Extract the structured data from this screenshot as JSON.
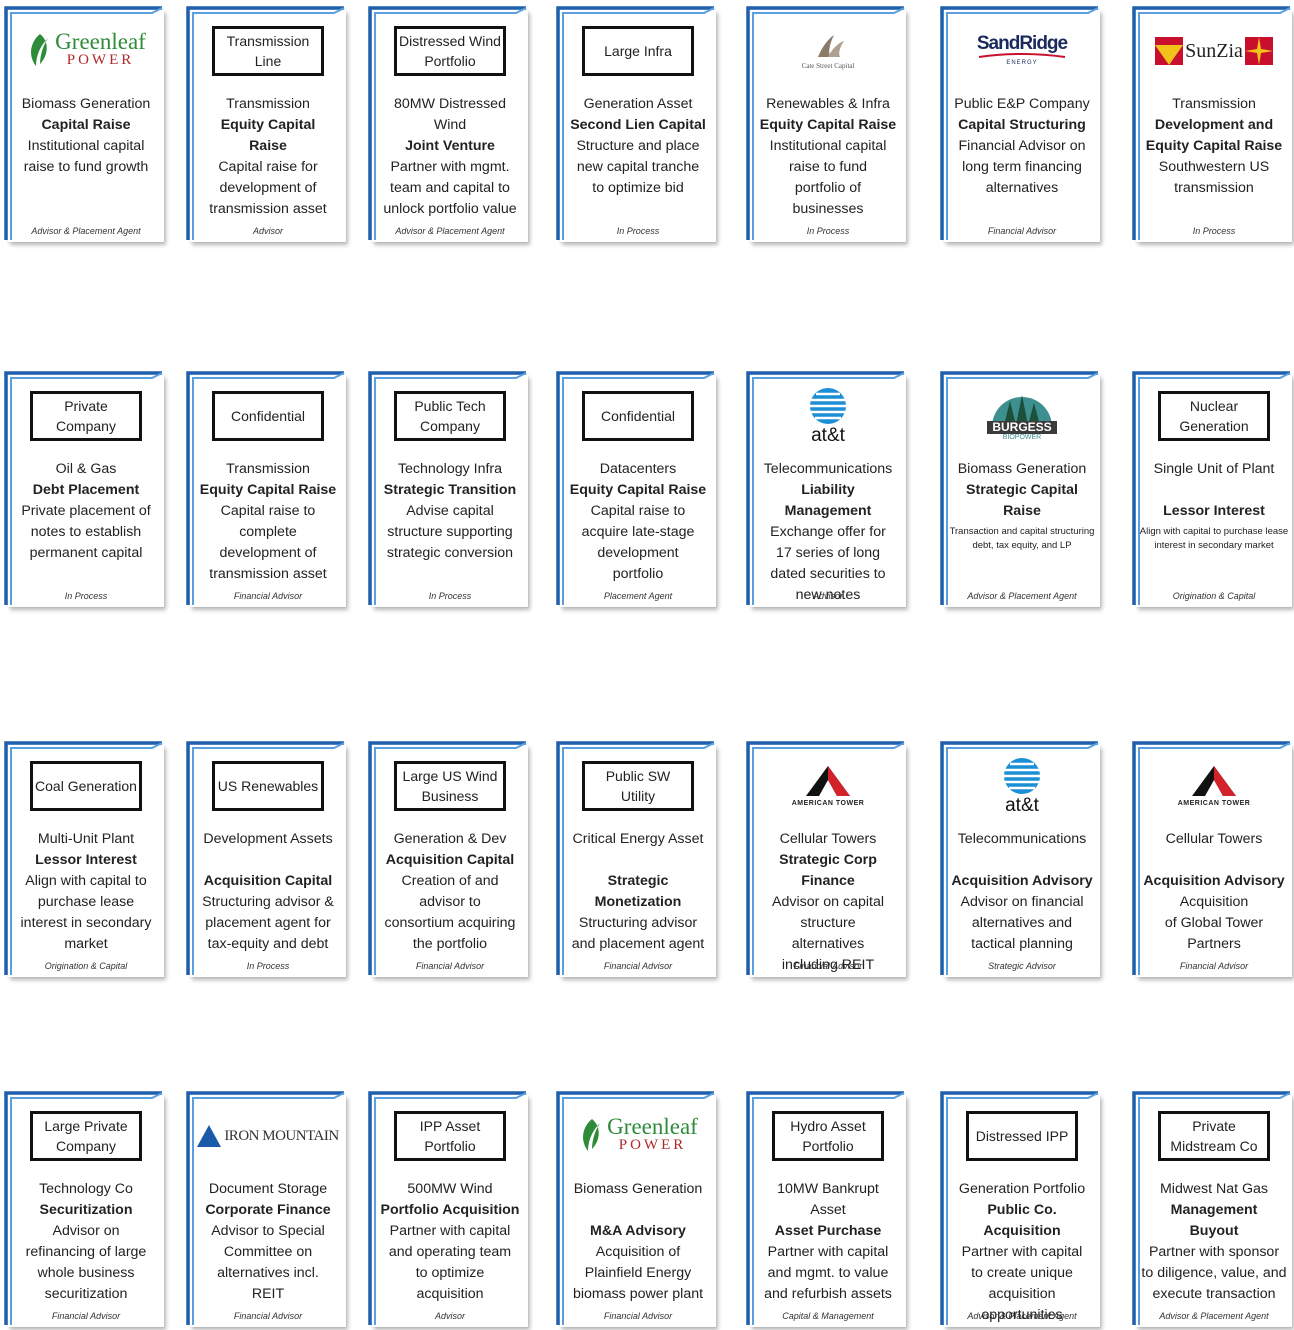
{
  "cards": [
    {
      "logo": "greenleaf",
      "logo_text": [
        "Greenleaf",
        "POWER"
      ],
      "lines": [
        {
          "t": "Biomass Generation"
        },
        {
          "t": "Capital Raise",
          "b": true
        },
        {
          "t": "Institutional capital"
        },
        {
          "t": "raise to fund growth"
        }
      ],
      "role": "Advisor & Placement Agent"
    },
    {
      "box": "Transmission Line",
      "lines": [
        {
          "t": "Transmission"
        },
        {
          "t": "Equity Capital",
          "b": true
        },
        {
          "t": "Raise",
          "b": true
        },
        {
          "t": "Capital raise for"
        },
        {
          "t": "development of"
        },
        {
          "t": "transmission asset"
        }
      ],
      "role": "Advisor"
    },
    {
      "box": "Distressed Wind Portfolio",
      "lines": [
        {
          "t": "80MW Distressed"
        },
        {
          "t": "Wind"
        },
        {
          "t": "Joint Venture",
          "b": true
        },
        {
          "t": "Partner with mgmt."
        },
        {
          "t": "team and capital to"
        },
        {
          "t": "unlock portfolio value"
        }
      ],
      "role": "Advisor & Placement Agent"
    },
    {
      "box": "Large Infra",
      "lines": [
        {
          "t": "Generation Asset"
        },
        {
          "t": "Second Lien Capital",
          "b": true
        },
        {
          "t": "Structure and place"
        },
        {
          "t": "new capital tranche"
        },
        {
          "t": "to optimize bid"
        }
      ],
      "role": "In Process"
    },
    {
      "logo": "catestreet",
      "logo_text": [
        "Cate Street Capital"
      ],
      "lines": [
        {
          "t": "Renewables & Infra"
        },
        {
          "t": "Equity Capital Raise",
          "b": true
        },
        {
          "t": "Institutional capital"
        },
        {
          "t": "raise to fund"
        },
        {
          "t": "portfolio of"
        },
        {
          "t": "businesses"
        }
      ],
      "role": "In Process"
    },
    {
      "logo": "sandridge",
      "logo_text": [
        "SandRidge",
        "ENERGY"
      ],
      "lines": [
        {
          "t": "Public E&P Company"
        },
        {
          "t": "Capital Structuring",
          "b": true
        },
        {
          "t": "Financial Advisor on"
        },
        {
          "t": "long term financing"
        },
        {
          "t": "alternatives"
        }
      ],
      "role": "Financial Advisor"
    },
    {
      "logo": "sunzia",
      "logo_text": [
        "SunZia"
      ],
      "lines": [
        {
          "t": "Transmission"
        },
        {
          "t": "Development and",
          "b": true
        },
        {
          "t": "Equity Capital Raise",
          "b": true
        },
        {
          "t": "Southwestern US"
        },
        {
          "t": "transmission"
        }
      ],
      "role": "In Process"
    },
    {
      "box": "Private Company",
      "lines": [
        {
          "t": "Oil & Gas"
        },
        {
          "t": "Debt Placement",
          "b": true
        },
        {
          "t": "Private placement of"
        },
        {
          "t": "notes to establish"
        },
        {
          "t": "permanent capital"
        }
      ],
      "role": "In Process"
    },
    {
      "box": "Confidential",
      "lines": [
        {
          "t": "Transmission"
        },
        {
          "t": "Equity Capital Raise",
          "b": true
        },
        {
          "t": "Capital raise to"
        },
        {
          "t": "complete"
        },
        {
          "t": "development of"
        },
        {
          "t": "transmission asset"
        }
      ],
      "role": "Financial Advisor"
    },
    {
      "box": "Public Tech Company",
      "lines": [
        {
          "t": "Technology Infra"
        },
        {
          "t": "Strategic Transition",
          "b": true
        },
        {
          "t": "Advise capital"
        },
        {
          "t": "structure supporting"
        },
        {
          "t": "strategic conversion"
        }
      ],
      "role": "In Process"
    },
    {
      "box": "Confidential",
      "lines": [
        {
          "t": "Datacenters"
        },
        {
          "t": "Equity Capital Raise",
          "b": true
        },
        {
          "t": "Capital raise to"
        },
        {
          "t": "acquire late-stage"
        },
        {
          "t": "development"
        },
        {
          "t": "portfolio"
        }
      ],
      "role": "Placement Agent"
    },
    {
      "logo": "att",
      "logo_text": [
        "at&t"
      ],
      "lines": [
        {
          "t": "Telecommunications"
        },
        {
          "t": "Liability",
          "b": true
        },
        {
          "t": "Management",
          "b": true
        },
        {
          "t": "Exchange offer for"
        },
        {
          "t": "17 series of long"
        },
        {
          "t": "dated securities to"
        },
        {
          "t": "new notes"
        }
      ],
      "role": "Advisor"
    },
    {
      "logo": "burgess",
      "logo_text": [
        "BURGESS",
        "BIOPOWER"
      ],
      "lines": [
        {
          "t": "Biomass Generation"
        },
        {
          "t": "Strategic Capital",
          "b": true
        },
        {
          "t": "Raise",
          "b": true
        },
        {
          "t": "Transaction and capital structuring debt, tax equity, and LP",
          "sm": true
        }
      ],
      "role": "Advisor & Placement Agent"
    },
    {
      "box": "Nuclear Generation",
      "lines": [
        {
          "t": "Single Unit of Plant"
        },
        {
          "gap": true
        },
        {
          "t": "Lessor Interest",
          "b": true
        },
        {
          "t": "Align with capital to purchase lease interest in secondary market",
          "sm": true
        }
      ],
      "role": "Origination & Capital"
    },
    {
      "box": "Coal Generation",
      "lines": [
        {
          "t": "Multi-Unit Plant"
        },
        {
          "t": "Lessor Interest",
          "b": true
        },
        {
          "t": "Align with capital to"
        },
        {
          "t": "purchase lease"
        },
        {
          "t": "interest in secondary"
        },
        {
          "t": "market"
        }
      ],
      "role": "Origination & Capital"
    },
    {
      "box": "US Renewables",
      "lines": [
        {
          "t": "Development Assets"
        },
        {
          "gap": true
        },
        {
          "t": "Acquisition Capital",
          "b": true
        },
        {
          "t": "Structuring advisor &"
        },
        {
          "t": "placement agent for"
        },
        {
          "t": "tax-equity and debt"
        }
      ],
      "role": "In Process"
    },
    {
      "box": "Large US Wind Business",
      "lines": [
        {
          "t": "Generation & Dev"
        },
        {
          "t": "Acquisition Capital",
          "b": true
        },
        {
          "t": "Creation of and"
        },
        {
          "t": "advisor to"
        },
        {
          "t": "consortium acquiring"
        },
        {
          "t": "the portfolio"
        }
      ],
      "role": "Financial Advisor"
    },
    {
      "box": "Public SW Utility",
      "lines": [
        {
          "t": "Critical Energy Asset"
        },
        {
          "gap": true
        },
        {
          "t": "Strategic",
          "b": true
        },
        {
          "t": "Monetization",
          "b": true
        },
        {
          "t": "Structuring advisor"
        },
        {
          "t": "and placement agent"
        }
      ],
      "role": "Financial Advisor"
    },
    {
      "logo": "amtower",
      "logo_text": [
        "AMERICAN TOWER"
      ],
      "lines": [
        {
          "t": "Cellular Towers"
        },
        {
          "t": "Strategic Corp",
          "b": true
        },
        {
          "t": "Finance",
          "b": true
        },
        {
          "t": "Advisor on capital"
        },
        {
          "t": "structure"
        },
        {
          "t": "alternatives"
        },
        {
          "t": "including REIT"
        }
      ],
      "role": "Financial Advisor"
    },
    {
      "logo": "att",
      "logo_text": [
        "at&t"
      ],
      "lines": [
        {
          "t": "Telecommunications"
        },
        {
          "gap": true
        },
        {
          "t": "Acquisition Advisory",
          "b": true
        },
        {
          "t": "Advisor on financial"
        },
        {
          "t": "alternatives and"
        },
        {
          "t": "tactical planning"
        }
      ],
      "role": "Strategic Advisor"
    },
    {
      "logo": "amtower",
      "logo_text": [
        "AMERICAN TOWER"
      ],
      "lines": [
        {
          "t": "Cellular Towers"
        },
        {
          "gap": true
        },
        {
          "t": "Acquisition Advisory",
          "b": true
        },
        {
          "t": "Acquisition"
        },
        {
          "t": "of Global Tower"
        },
        {
          "t": "Partners"
        }
      ],
      "role": "Financial Advisor"
    },
    {
      "box": "Large Private Company",
      "lines": [
        {
          "t": "Technology Co"
        },
        {
          "t": "Securitization",
          "b": true
        },
        {
          "t": "Advisor on"
        },
        {
          "t": "refinancing of large"
        },
        {
          "t": "whole business"
        },
        {
          "t": "securitization"
        }
      ],
      "role": "Financial Advisor"
    },
    {
      "logo": "ironmountain",
      "logo_text": [
        "IRON MOUNTAIN"
      ],
      "lines": [
        {
          "t": "Document Storage"
        },
        {
          "t": "Corporate Finance",
          "b": true
        },
        {
          "t": "Advisor to Special"
        },
        {
          "t": "Committee on"
        },
        {
          "t": "alternatives incl."
        },
        {
          "t": "REIT"
        }
      ],
      "role": "Financial Advisor"
    },
    {
      "box": "IPP Asset Portfolio",
      "lines": [
        {
          "t": "500MW Wind"
        },
        {
          "t": "Portfolio Acquisition",
          "b": true
        },
        {
          "t": "Partner with capital"
        },
        {
          "t": "and operating team"
        },
        {
          "t": "to optimize"
        },
        {
          "t": "acquisition"
        }
      ],
      "role": "Advisor"
    },
    {
      "logo": "greenleaf",
      "logo_text": [
        "Greenleaf",
        "POWER"
      ],
      "lines": [
        {
          "t": "Biomass Generation"
        },
        {
          "gap": true
        },
        {
          "t": "M&A Advisory",
          "b": true
        },
        {
          "t": "Acquisition of"
        },
        {
          "t": "Plainfield Energy"
        },
        {
          "t": "biomass power plant"
        }
      ],
      "role": "Financial Advisor"
    },
    {
      "box": "Hydro Asset Portfolio",
      "lines": [
        {
          "t": "10MW Bankrupt"
        },
        {
          "t": "Asset"
        },
        {
          "t": "Asset Purchase",
          "b": true
        },
        {
          "t": "Partner with capital"
        },
        {
          "t": "and mgmt. to value"
        },
        {
          "t": "and refurbish assets"
        }
      ],
      "role": "Capital & Management"
    },
    {
      "box": "Distressed IPP",
      "lines": [
        {
          "t": "Generation Portfolio"
        },
        {
          "t": "Public Co.",
          "b": true
        },
        {
          "t": "Acquisition",
          "b": true
        },
        {
          "t": "Partner with capital"
        },
        {
          "t": "to create unique"
        },
        {
          "t": "acquisition"
        },
        {
          "t": "opportunities"
        }
      ],
      "role": "Advisor & Placement Agent"
    },
    {
      "box": "Private Midstream Co",
      "lines": [
        {
          "t": "Midwest Nat Gas"
        },
        {
          "t": "Management",
          "b": true
        },
        {
          "t": "Buyout",
          "b": true
        },
        {
          "t": "Partner with sponsor"
        },
        {
          "t": "to diligence, value, and"
        },
        {
          "t": "execute transaction"
        }
      ],
      "role": "Advisor & Placement Agent"
    }
  ],
  "colors": {
    "bracket_dark": "#1f5fae",
    "bracket_light": "#5aa0e0",
    "att_blue": "#1a8fd6",
    "tower_red": "#d2232a",
    "greenleaf_green": "#2e8b3a",
    "burgess_teal": "#3e8f8f",
    "sunzia_yellow": "#f2c21b",
    "sunzia_red": "#c8102e"
  }
}
